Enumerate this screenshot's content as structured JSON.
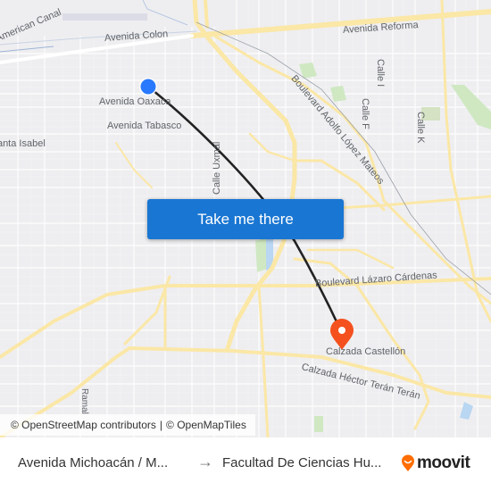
{
  "map": {
    "street_labels": [
      {
        "id": "american-canal",
        "text": "American Canal"
      },
      {
        "id": "avenida-colon",
        "text": "Avenida Colon"
      },
      {
        "id": "avenida-reforma",
        "text": "Avenida Reforma"
      },
      {
        "id": "calle-i",
        "text": "Calle I"
      },
      {
        "id": "boulevard-adolfo-lopez-mateos",
        "text": "Boulevard Adolfo López Mateos"
      },
      {
        "id": "calle-f",
        "text": "Calle F"
      },
      {
        "id": "calle-k",
        "text": "Calle K"
      },
      {
        "id": "avenida-oaxaca",
        "text": "Avenida Oaxaca"
      },
      {
        "id": "avenida-tabasco",
        "text": "Avenida Tabasco"
      },
      {
        "id": "santa-isabel",
        "text": "Avenida Santa Isabel"
      },
      {
        "id": "calle-uxmal",
        "text": "Calle Uxmal"
      },
      {
        "id": "boulevard-lazaro-cardenas",
        "text": "Boulevard Lázaro Cárdenas"
      },
      {
        "id": "calzada-castellon",
        "text": "Calzada Castellón"
      },
      {
        "id": "calzada-hector-teran",
        "text": "Calzada Héctor Terán Terán"
      },
      {
        "id": "ramal",
        "text": "Ramal"
      }
    ],
    "origin_marker": {
      "color": "#2979ff"
    },
    "destination_marker": {
      "color": "#f4511e"
    },
    "route_color": "#222222",
    "cta_button": "Take me there",
    "attribution": {
      "osm": "© OpenStreetMap contributors",
      "separator": "|",
      "tiles": "© OpenMapTiles"
    }
  },
  "footer": {
    "from": "Avenida Michoacán / M...",
    "arrow": "→",
    "to": "Facultad De Ciencias Hu...",
    "brand": "moovit",
    "brand_color": "#ff6d00"
  }
}
